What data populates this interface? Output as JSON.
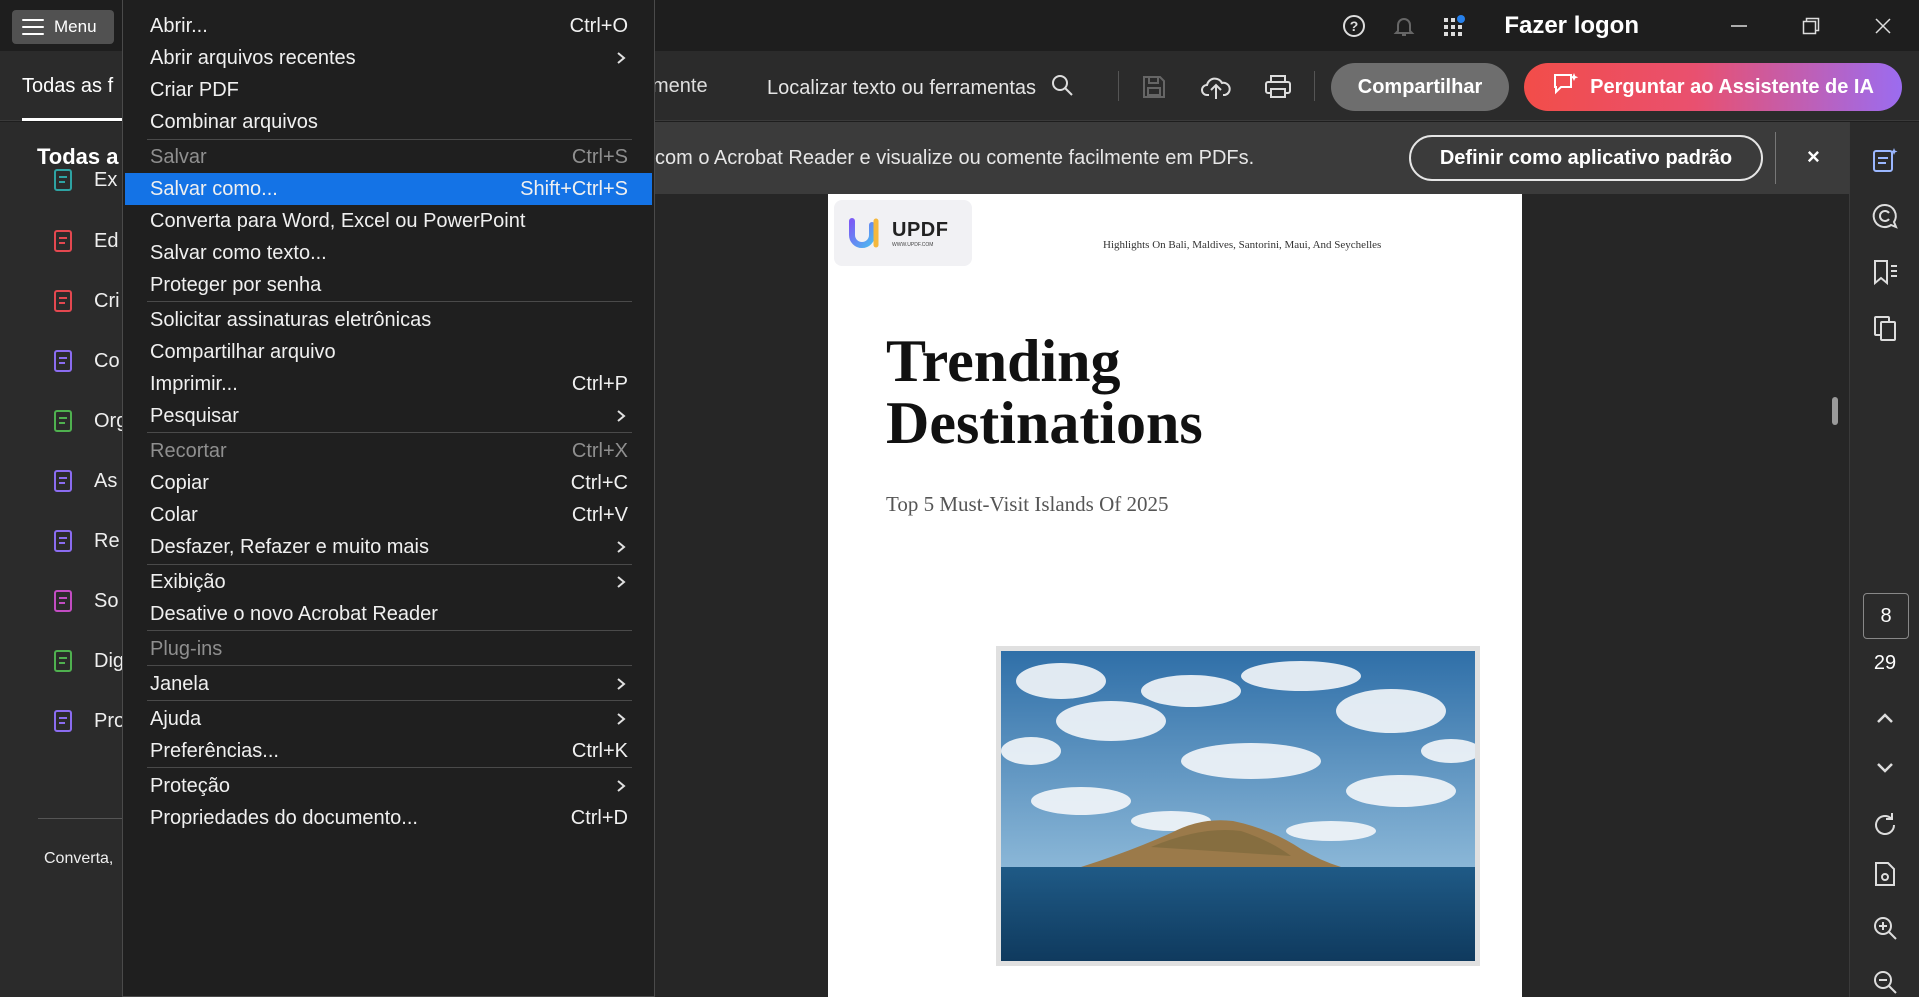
{
  "titlebar": {
    "menu_label": "Menu",
    "login_label": "Fazer logon",
    "help_icon": "help-circle-icon",
    "bell_icon": "bell-icon",
    "apps_icon": "apps-grid-icon"
  },
  "toolbar": {
    "tab_all": "Todas as f",
    "tab_comment": "mente",
    "search_label": "Localizar texto ou ferramentas",
    "share_label": "Compartilhar",
    "ai_label": "Perguntar ao Assistente de IA"
  },
  "leftpanel": {
    "title": "Todas a",
    "items": [
      {
        "label": "Ex",
        "icon": "export-pdf-icon",
        "color": "#2ea3a3"
      },
      {
        "label": "Ed",
        "icon": "edit-pdf-icon",
        "color": "#e34850"
      },
      {
        "label": "Cri",
        "icon": "create-pdf-icon",
        "color": "#e34850"
      },
      {
        "label": "Co",
        "icon": "combine-icon",
        "color": "#8b6cf0"
      },
      {
        "label": "Org",
        "icon": "organize-icon",
        "color": "#4fb14f"
      },
      {
        "label": "As",
        "icon": "ai-assistant-icon",
        "color": "#8b6cf0"
      },
      {
        "label": "Re",
        "icon": "redact-icon",
        "color": "#8b6cf0"
      },
      {
        "label": "So",
        "icon": "signature-request-icon",
        "color": "#c24cc2"
      },
      {
        "label": "Dig",
        "icon": "scan-icon",
        "color": "#4fb14f"
      },
      {
        "label": "Pro",
        "icon": "protect-icon",
        "color": "#8b6cf0"
      }
    ],
    "footer": "Converta,"
  },
  "banner": {
    "text": "com o Acrobat Reader e visualize ou comente facilmente em PDFs.",
    "button": "Definir como aplicativo padrão",
    "close": "×"
  },
  "document": {
    "logo_main": "UPDF",
    "logo_sub": "WWW.UPDF.COM",
    "header_text": "Highlights On Bali, Maldives, Santorini, Maui, And  Seychelles",
    "title_line1": "Trending",
    "title_line2": "Destinations",
    "subtitle": "Top 5 Must-Visit Islands Of 2025"
  },
  "pager": {
    "current": "8",
    "total": "29"
  },
  "menu": {
    "items": [
      {
        "label": "Abrir...",
        "shortcut": "Ctrl+O",
        "submenu": false,
        "disabled": false
      },
      {
        "label": "Abrir arquivos recentes",
        "shortcut": "",
        "submenu": true,
        "disabled": false
      },
      {
        "label": "Criar PDF",
        "shortcut": "",
        "submenu": false,
        "disabled": false
      },
      {
        "label": "Combinar arquivos",
        "shortcut": "",
        "submenu": false,
        "disabled": false
      },
      {
        "label": "Salvar",
        "shortcut": "Ctrl+S",
        "submenu": false,
        "disabled": true
      },
      {
        "label": "Salvar como...",
        "shortcut": "Shift+Ctrl+S",
        "submenu": false,
        "disabled": false,
        "highlighted": true
      },
      {
        "label": "Converta para Word, Excel ou PowerPoint",
        "shortcut": "",
        "submenu": false,
        "disabled": false
      },
      {
        "label": "Salvar como texto...",
        "shortcut": "",
        "submenu": false,
        "disabled": false
      },
      {
        "label": "Proteger por senha",
        "shortcut": "",
        "submenu": false,
        "disabled": false
      },
      {
        "label": "Solicitar assinaturas eletrônicas",
        "shortcut": "",
        "submenu": false,
        "disabled": false
      },
      {
        "label": "Compartilhar arquivo",
        "shortcut": "",
        "submenu": false,
        "disabled": false
      },
      {
        "label": "Imprimir...",
        "shortcut": "Ctrl+P",
        "submenu": false,
        "disabled": false
      },
      {
        "label": "Pesquisar",
        "shortcut": "",
        "submenu": true,
        "disabled": false
      },
      {
        "label": "Recortar",
        "shortcut": "Ctrl+X",
        "submenu": false,
        "disabled": true
      },
      {
        "label": "Copiar",
        "shortcut": "Ctrl+C",
        "submenu": false,
        "disabled": false
      },
      {
        "label": "Colar",
        "shortcut": "Ctrl+V",
        "submenu": false,
        "disabled": false
      },
      {
        "label": "Desfazer, Refazer e muito mais",
        "shortcut": "",
        "submenu": true,
        "disabled": false
      },
      {
        "label": "Exibição",
        "shortcut": "",
        "submenu": true,
        "disabled": false
      },
      {
        "label": "Desative o novo Acrobat Reader",
        "shortcut": "",
        "submenu": false,
        "disabled": false
      },
      {
        "label": "Plug-ins",
        "shortcut": "",
        "submenu": false,
        "disabled": true
      },
      {
        "label": "Janela",
        "shortcut": "",
        "submenu": true,
        "disabled": false
      },
      {
        "label": "Ajuda",
        "shortcut": "",
        "submenu": true,
        "disabled": false
      },
      {
        "label": "Preferências...",
        "shortcut": "Ctrl+K",
        "submenu": false,
        "disabled": false
      },
      {
        "label": "Proteção",
        "shortcut": "",
        "submenu": true,
        "disabled": false
      },
      {
        "label": "Propriedades do documento...",
        "shortcut": "Ctrl+D",
        "submenu": false,
        "disabled": false
      }
    ]
  }
}
